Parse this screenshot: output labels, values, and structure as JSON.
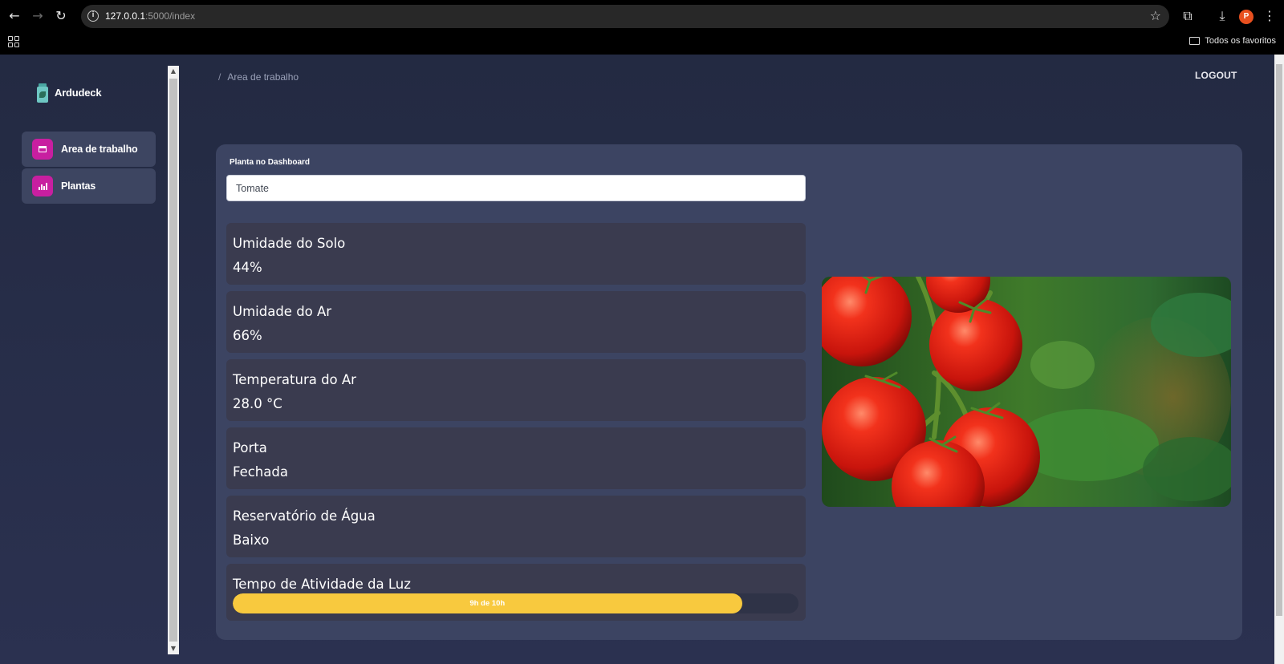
{
  "browser": {
    "url_host": "127.0.0.1",
    "url_path": ":5000/index",
    "profile_initial": "P",
    "bookmarks_folder": "Todos os favoritos"
  },
  "sidebar": {
    "brand": "Ardudeck",
    "items": [
      {
        "label": "Area de trabalho",
        "icon": "store-icon"
      },
      {
        "label": "Plantas",
        "icon": "chart-icon"
      }
    ]
  },
  "header": {
    "breadcrumb_sep": "/",
    "breadcrumb": "Area de trabalho",
    "logout": "LOGOUT"
  },
  "dashboard": {
    "select_label": "Planta no Dashboard",
    "selected_plant": "Tomate",
    "metrics": [
      {
        "title": "Umidade do Solo",
        "value": "44%"
      },
      {
        "title": "Umidade do Ar",
        "value": "66%"
      },
      {
        "title": "Temperatura do Ar",
        "value": "28.0 °C"
      },
      {
        "title": "Porta",
        "value": "Fechada"
      },
      {
        "title": "Reservatório de Água",
        "value": "Baixo"
      }
    ],
    "light": {
      "title": "Tempo de Atividade da Luz",
      "progress_text": "9h de 10h",
      "progress_fraction": 0.9
    },
    "photo": "tomato-plant-photo"
  },
  "colors": {
    "accent": "#c81fa0",
    "progress": "#f8c93e",
    "card": "#3c4462",
    "metric": "#3a3b4f"
  }
}
